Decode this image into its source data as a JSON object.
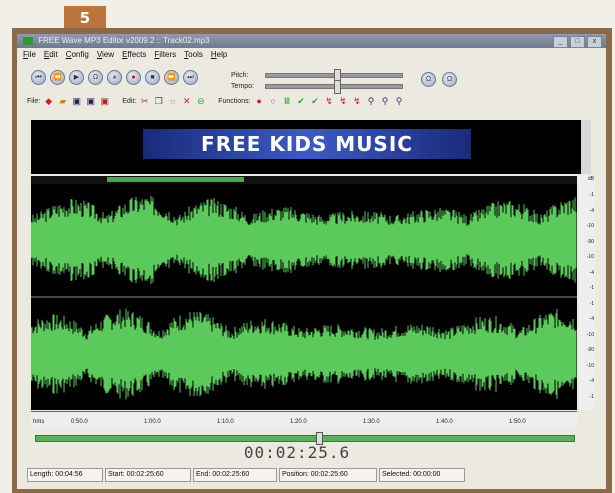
{
  "step_number": "5",
  "window": {
    "title": "FREE Wave MP3 Editor v2009.2 :: Track02.mp3"
  },
  "window_buttons": {
    "minimize": "_",
    "maximize": "□",
    "close": "x"
  },
  "menu": [
    "File",
    "Edit",
    "Config",
    "View",
    "Effects",
    "Filters",
    "Tools",
    "Help"
  ],
  "transport": {
    "glyphs": [
      "⏮",
      "⏪",
      "▶",
      "Ω",
      "⏸",
      "●",
      "■",
      "⏩",
      "⏭"
    ]
  },
  "controls": {
    "pitch_label": "Pitch:",
    "tempo_label": "Tempo:",
    "pitch_level": 0.5,
    "tempo_level": 0.5
  },
  "side_buttons": [
    "Ω",
    "Ω"
  ],
  "toolbar": {
    "file_label": "File:",
    "edit_label": "Edit:",
    "functions_label": "Functions:"
  },
  "banner": {
    "text": "FREE KIDS MUSIC"
  },
  "overview": {
    "selection_start": 0.14,
    "selection_end": 0.39
  },
  "ruler": {
    "unit": "dB",
    "ticks": [
      "-1",
      "-4",
      "-10",
      "-90",
      "-10",
      "-4",
      "-1",
      "-1",
      "-4",
      "-10",
      "-90",
      "-10",
      "-4",
      "-1"
    ]
  },
  "timeline": {
    "format": "hms",
    "labels": [
      "0:50.0",
      "1:00.0",
      "1:10.0",
      "1:20.0",
      "1:30.0",
      "1:40.0",
      "1:50.0"
    ]
  },
  "position": {
    "fraction": 0.52,
    "timecode": "00:02:25.6"
  },
  "status": {
    "length": "Length: 00:04:56",
    "start": "Start: 00:02:25:60",
    "end": "End: 00:02:25:60",
    "position": "Position: 00:02:25:60",
    "selected": "Selected: 00:00:00"
  },
  "colors": {
    "wave": "#5cc95c",
    "accent": "#b9753d"
  }
}
